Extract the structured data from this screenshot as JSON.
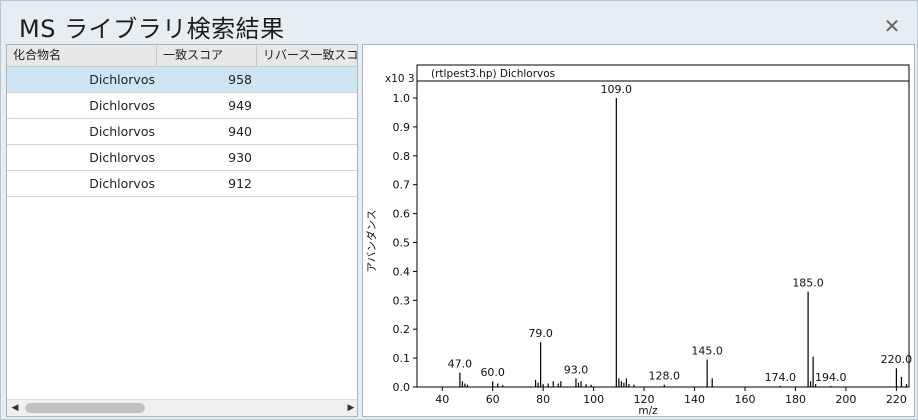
{
  "window": {
    "title": "MS ライブラリ検索結果"
  },
  "table": {
    "columns": [
      "化合物名",
      "一致スコア",
      "リバース一致スコア"
    ],
    "rows": [
      {
        "name": "Dichlorvos",
        "score": "958"
      },
      {
        "name": "Dichlorvos",
        "score": "949"
      },
      {
        "name": "Dichlorvos",
        "score": "940"
      },
      {
        "name": "Dichlorvos",
        "score": "930"
      },
      {
        "name": "Dichlorvos",
        "score": "912"
      }
    ],
    "selected_index": 0
  },
  "icons": {
    "close": "close-icon",
    "scroll_left": "chevron-left-icon",
    "scroll_right": "chevron-right-icon"
  },
  "colors": {
    "selected_row": "#cde4f3",
    "bar": "#000000"
  },
  "chart_data": {
    "type": "bar",
    "title": "(rtlpest3.hp) Dichlorvos",
    "xlabel": "m/z",
    "ylabel": "アバンダンス",
    "y_multiplier": "x10 3",
    "xlim": [
      30,
      225
    ],
    "ylim": [
      0,
      1.0
    ],
    "xticks": [
      40,
      60,
      80,
      100,
      120,
      140,
      160,
      180,
      200,
      220
    ],
    "yticks": [
      "0.0",
      "0.1",
      "0.2",
      "0.3",
      "0.4",
      "0.5",
      "0.6",
      "0.7",
      "0.8",
      "0.9",
      "1.0"
    ],
    "peaks": [
      {
        "mz": 47,
        "y": 0.05,
        "label": "47.0"
      },
      {
        "mz": 48,
        "y": 0.02
      },
      {
        "mz": 49,
        "y": 0.012
      },
      {
        "mz": 50,
        "y": 0.008
      },
      {
        "mz": 60,
        "y": 0.02,
        "label": "60.0"
      },
      {
        "mz": 62,
        "y": 0.012
      },
      {
        "mz": 64,
        "y": 0.006
      },
      {
        "mz": 77,
        "y": 0.025
      },
      {
        "mz": 78,
        "y": 0.015
      },
      {
        "mz": 79,
        "y": 0.155,
        "label": "79.0"
      },
      {
        "mz": 80,
        "y": 0.01
      },
      {
        "mz": 82,
        "y": 0.012
      },
      {
        "mz": 84,
        "y": 0.02
      },
      {
        "mz": 86,
        "y": 0.012
      },
      {
        "mz": 87,
        "y": 0.02
      },
      {
        "mz": 93,
        "y": 0.03,
        "label": "93.0"
      },
      {
        "mz": 94,
        "y": 0.015
      },
      {
        "mz": 95,
        "y": 0.02
      },
      {
        "mz": 97,
        "y": 0.01
      },
      {
        "mz": 99,
        "y": 0.008
      },
      {
        "mz": 109,
        "y": 1.0,
        "label": "109.0"
      },
      {
        "mz": 110,
        "y": 0.03
      },
      {
        "mz": 111,
        "y": 0.02
      },
      {
        "mz": 112,
        "y": 0.015
      },
      {
        "mz": 113,
        "y": 0.03
      },
      {
        "mz": 114,
        "y": 0.01
      },
      {
        "mz": 116,
        "y": 0.008
      },
      {
        "mz": 128,
        "y": 0.008,
        "label": "128.0"
      },
      {
        "mz": 145,
        "y": 0.095,
        "label": "145.0"
      },
      {
        "mz": 147,
        "y": 0.03
      },
      {
        "mz": 174,
        "y": 0.004,
        "label": "174.0"
      },
      {
        "mz": 185,
        "y": 0.33,
        "label": "185.0"
      },
      {
        "mz": 186,
        "y": 0.02
      },
      {
        "mz": 187,
        "y": 0.105
      },
      {
        "mz": 188,
        "y": 0.01
      },
      {
        "mz": 194,
        "y": 0.004,
        "label": "194.0"
      },
      {
        "mz": 220,
        "y": 0.065,
        "label": "220.0"
      },
      {
        "mz": 222,
        "y": 0.035
      },
      {
        "mz": 224,
        "y": 0.01
      }
    ]
  }
}
